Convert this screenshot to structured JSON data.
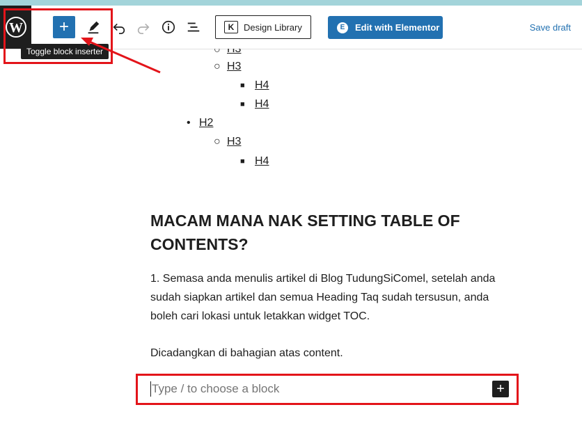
{
  "toolbar": {
    "inserter_tooltip": "Toggle block inserter",
    "design_library_label": "Design Library",
    "elementor_label": "Edit with Elementor",
    "save_draft_label": "Save draft"
  },
  "toc": {
    "items": [
      {
        "label": "H3",
        "level": 2
      },
      {
        "label": "H3",
        "level": 2
      },
      {
        "label": "H4",
        "level": 3
      },
      {
        "label": "H4",
        "level": 3
      },
      {
        "label": "H2",
        "level": 1
      },
      {
        "label": "H3",
        "level": 2
      },
      {
        "label": "H4",
        "level": 3
      }
    ]
  },
  "content": {
    "heading": "MACAM MANA NAK SETTING TABLE OF CONTENTS?",
    "para1": "1. Semasa anda menulis artikel di Blog TudungSiComel, setelah anda sudah siapkan artikel dan semua Heading Taq sudah tersusun, anda boleh cari lokasi untuk letakkan widget TOC.",
    "para2": "Dicadangkan di bahagian atas content."
  },
  "block_input": {
    "placeholder": "Type / to choose a block"
  },
  "colors": {
    "accent": "#2271b1",
    "highlight": "#e3141a"
  }
}
